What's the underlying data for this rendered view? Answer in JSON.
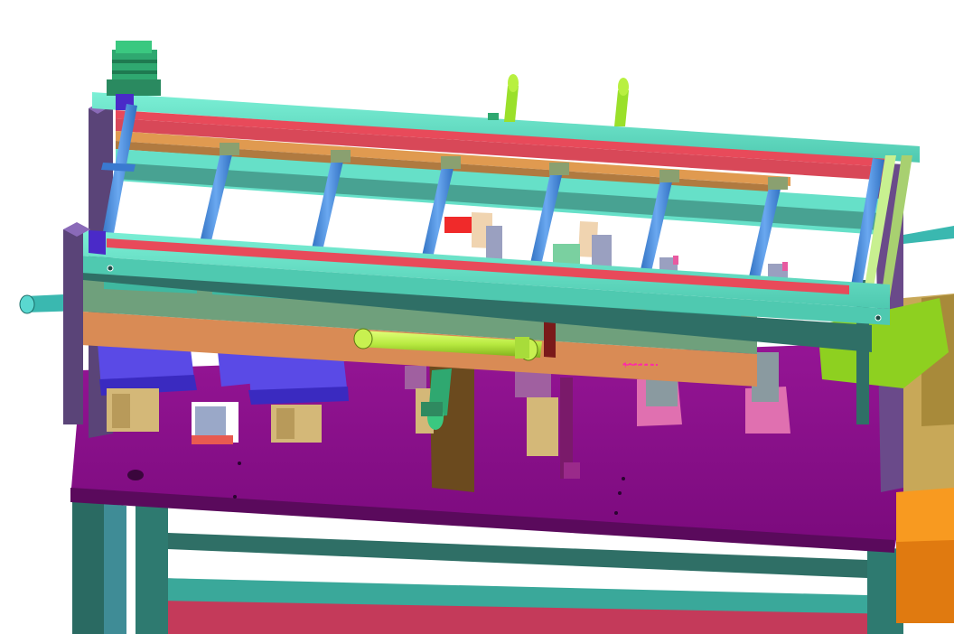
{
  "view": {
    "background": "#ffffff",
    "colors": {
      "frame_teal": "#66e0c8",
      "frame_dark": "#2f6f66",
      "red_strip": "#ec5a6a",
      "orange_plate": "#d98b55",
      "sage_plate": "#6fa07c",
      "magenta_base": "#8c0f8c",
      "blue_slide": "#4f8fe0",
      "cylinder_green": "#bff04a",
      "motor_green": "#2fa870",
      "violet_block": "#5a4ae6",
      "pink_bracket": "#e85aa0",
      "cream_block": "#f0d4b0",
      "brown_post": "#6b4a1e",
      "purple_post": "#6a4a8a",
      "orange_box": "#f89a20",
      "khaki_box": "#c0a050"
    },
    "icons": [
      "motor-icon",
      "pneumatic-cylinder-icon",
      "linear-slide-icon",
      "clamp-icon",
      "coordinate-triad-icon"
    ]
  }
}
